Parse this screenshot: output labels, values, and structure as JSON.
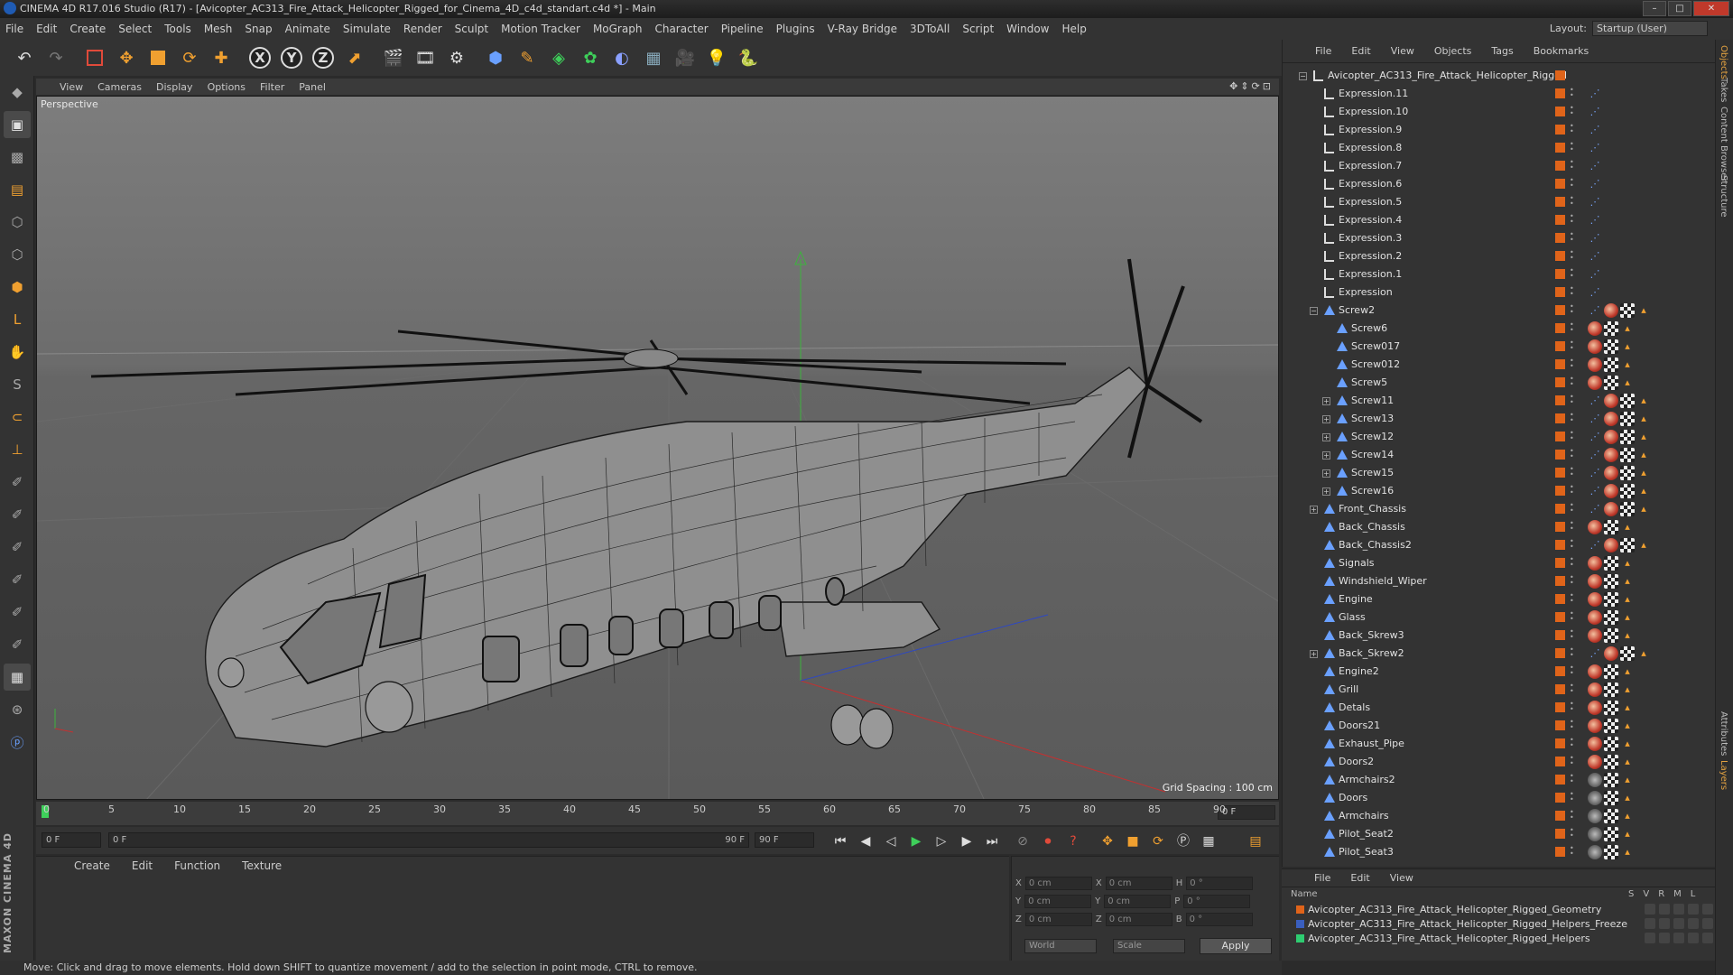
{
  "window": {
    "title": "CINEMA 4D R17.016 Studio (R17) - [Avicopter_AC313_Fire_Attack_Helicopter_Rigged_for_Cinema_4D_c4d_standart.c4d *] - Main"
  },
  "menubar": {
    "items": [
      "File",
      "Edit",
      "Create",
      "Select",
      "Tools",
      "Mesh",
      "Snap",
      "Animate",
      "Simulate",
      "Render",
      "Sculpt",
      "Motion Tracker",
      "MoGraph",
      "Character",
      "Pipeline",
      "Plugins",
      "V-Ray Bridge",
      "3DToAll",
      "Script",
      "Window",
      "Help"
    ],
    "layout_label": "Layout:",
    "layout_value": "Startup (User)"
  },
  "toolbar": {
    "axis_x": "X",
    "axis_y": "Y",
    "axis_z": "Z"
  },
  "viewport": {
    "menu": [
      "View",
      "Cameras",
      "Display",
      "Options",
      "Filter",
      "Panel"
    ],
    "label": "Perspective",
    "grid_spacing": "Grid Spacing : 100 cm"
  },
  "timeline": {
    "ticks": [
      "0",
      "5",
      "10",
      "15",
      "20",
      "25",
      "30",
      "35",
      "40",
      "45",
      "50",
      "55",
      "60",
      "65",
      "70",
      "75",
      "80",
      "85",
      "90"
    ],
    "current_frame": "0 F"
  },
  "transport": {
    "start_field": "0 F",
    "range_start": "0 F",
    "range_end": "90 F",
    "end_field": "90 F"
  },
  "material_panel": {
    "menu": [
      "Create",
      "Edit",
      "Function",
      "Texture"
    ]
  },
  "coords": {
    "x_pos": "0 cm",
    "y_pos": "0 cm",
    "z_pos": "0 cm",
    "x_size": "0 cm",
    "y_size": "0 cm",
    "z_size": "0 cm",
    "h": "0 °",
    "p": "0 °",
    "b": "0 °",
    "mode_world": "World",
    "mode_scale": "Scale",
    "apply_label": "Apply",
    "label_x": "X",
    "label_y": "Y",
    "label_z": "Z",
    "label_h": "H",
    "label_p": "P",
    "label_b": "B"
  },
  "status": {
    "text": "Move: Click and drag to move elements. Hold down SHIFT to quantize movement / add to the selection in point mode, CTRL to remove."
  },
  "object_manager": {
    "menu": [
      "File",
      "Edit",
      "View",
      "Objects",
      "Tags",
      "Bookmarks"
    ],
    "root": "Avicopter_AC313_Fire_Attack_Helicopter_Rigged",
    "objects": [
      {
        "name": "Expression.11",
        "kind": "null",
        "depth": 1,
        "tags": "xp"
      },
      {
        "name": "Expression.10",
        "kind": "null",
        "depth": 1,
        "tags": "xp"
      },
      {
        "name": "Expression.9",
        "kind": "null",
        "depth": 1,
        "tags": "xp"
      },
      {
        "name": "Expression.8",
        "kind": "null",
        "depth": 1,
        "tags": "xp"
      },
      {
        "name": "Expression.7",
        "kind": "null",
        "depth": 1,
        "tags": "xp"
      },
      {
        "name": "Expression.6",
        "kind": "null",
        "depth": 1,
        "tags": "xp"
      },
      {
        "name": "Expression.5",
        "kind": "null",
        "depth": 1,
        "tags": "xp"
      },
      {
        "name": "Expression.4",
        "kind": "null",
        "depth": 1,
        "tags": "xp"
      },
      {
        "name": "Expression.3",
        "kind": "null",
        "depth": 1,
        "tags": "xp"
      },
      {
        "name": "Expression.2",
        "kind": "null",
        "depth": 1,
        "tags": "xp"
      },
      {
        "name": "Expression.1",
        "kind": "null",
        "depth": 1,
        "tags": "xp"
      },
      {
        "name": "Expression",
        "kind": "null",
        "depth": 1,
        "tags": "xp"
      },
      {
        "name": "Screw2",
        "kind": "poly",
        "depth": 1,
        "tags": "xp-mat",
        "expand": "-"
      },
      {
        "name": "Screw6",
        "kind": "poly",
        "depth": 2,
        "tags": "mat"
      },
      {
        "name": "Screw017",
        "kind": "poly",
        "depth": 2,
        "tags": "mat"
      },
      {
        "name": "Screw012",
        "kind": "poly",
        "depth": 2,
        "tags": "mat"
      },
      {
        "name": "Screw5",
        "kind": "poly",
        "depth": 2,
        "tags": "mat"
      },
      {
        "name": "Screw11",
        "kind": "poly",
        "depth": 2,
        "tags": "xp-mat",
        "expand": "+"
      },
      {
        "name": "Screw13",
        "kind": "poly",
        "depth": 2,
        "tags": "xp-mat",
        "expand": "+"
      },
      {
        "name": "Screw12",
        "kind": "poly",
        "depth": 2,
        "tags": "xp-mat",
        "expand": "+"
      },
      {
        "name": "Screw14",
        "kind": "poly",
        "depth": 2,
        "tags": "xp-mat",
        "expand": "+"
      },
      {
        "name": "Screw15",
        "kind": "poly",
        "depth": 2,
        "tags": "xp-mat",
        "expand": "+"
      },
      {
        "name": "Screw16",
        "kind": "poly",
        "depth": 2,
        "tags": "xp-mat",
        "expand": "+"
      },
      {
        "name": "Front_Chassis",
        "kind": "poly",
        "depth": 1,
        "tags": "xp-mat",
        "expand": "+"
      },
      {
        "name": "Back_Chassis",
        "kind": "poly",
        "depth": 1,
        "tags": "mat"
      },
      {
        "name": "Back_Chassis2",
        "kind": "poly",
        "depth": 1,
        "tags": "xp-mat"
      },
      {
        "name": "Signals",
        "kind": "poly",
        "depth": 1,
        "tags": "mat"
      },
      {
        "name": "Windshield_Wiper",
        "kind": "poly",
        "depth": 1,
        "tags": "mat"
      },
      {
        "name": "Engine",
        "kind": "poly",
        "depth": 1,
        "tags": "mat"
      },
      {
        "name": "Glass",
        "kind": "poly",
        "depth": 1,
        "tags": "mat"
      },
      {
        "name": "Back_Skrew3",
        "kind": "poly",
        "depth": 1,
        "tags": "mat"
      },
      {
        "name": "Back_Skrew2",
        "kind": "poly",
        "depth": 1,
        "tags": "xp-mat",
        "expand": "+"
      },
      {
        "name": "Engine2",
        "kind": "poly",
        "depth": 1,
        "tags": "mat"
      },
      {
        "name": "Grill",
        "kind": "poly",
        "depth": 1,
        "tags": "mat"
      },
      {
        "name": "Detals",
        "kind": "poly",
        "depth": 1,
        "tags": "mat"
      },
      {
        "name": "Doors21",
        "kind": "poly",
        "depth": 1,
        "tags": "mat"
      },
      {
        "name": "Exhaust_Pipe",
        "kind": "poly",
        "depth": 1,
        "tags": "mat"
      },
      {
        "name": "Doors2",
        "kind": "poly",
        "depth": 1,
        "tags": "mat"
      },
      {
        "name": "Armchairs2",
        "kind": "poly",
        "depth": 1,
        "tags": "ph"
      },
      {
        "name": "Doors",
        "kind": "poly",
        "depth": 1,
        "tags": "ph"
      },
      {
        "name": "Armchairs",
        "kind": "poly",
        "depth": 1,
        "tags": "ph"
      },
      {
        "name": "Pilot_Seat2",
        "kind": "poly",
        "depth": 1,
        "tags": "ph"
      },
      {
        "name": "Pilot_Seat3",
        "kind": "poly",
        "depth": 1,
        "tags": "ph"
      }
    ]
  },
  "layer_manager": {
    "menu": [
      "File",
      "Edit",
      "View"
    ],
    "header_name": "Name",
    "header_cols": "SVRML",
    "layers": [
      {
        "name": "Avicopter_AC313_Fire_Attack_Helicopter_Rigged_Geometry",
        "color": "#e0641a"
      },
      {
        "name": "Avicopter_AC313_Fire_Attack_Helicopter_Rigged_Helpers_Freeze",
        "color": "#3a5fbf"
      },
      {
        "name": "Avicopter_AC313_Fire_Attack_Helicopter_Rigged_Helpers",
        "color": "#2ecc71"
      }
    ]
  },
  "right_tabs": [
    "Objects",
    "Takes",
    "Content Browser",
    "Structure",
    "Attributes",
    "Layers"
  ],
  "colors": {
    "accent": "#e0641a",
    "selection": "#f0a030"
  }
}
